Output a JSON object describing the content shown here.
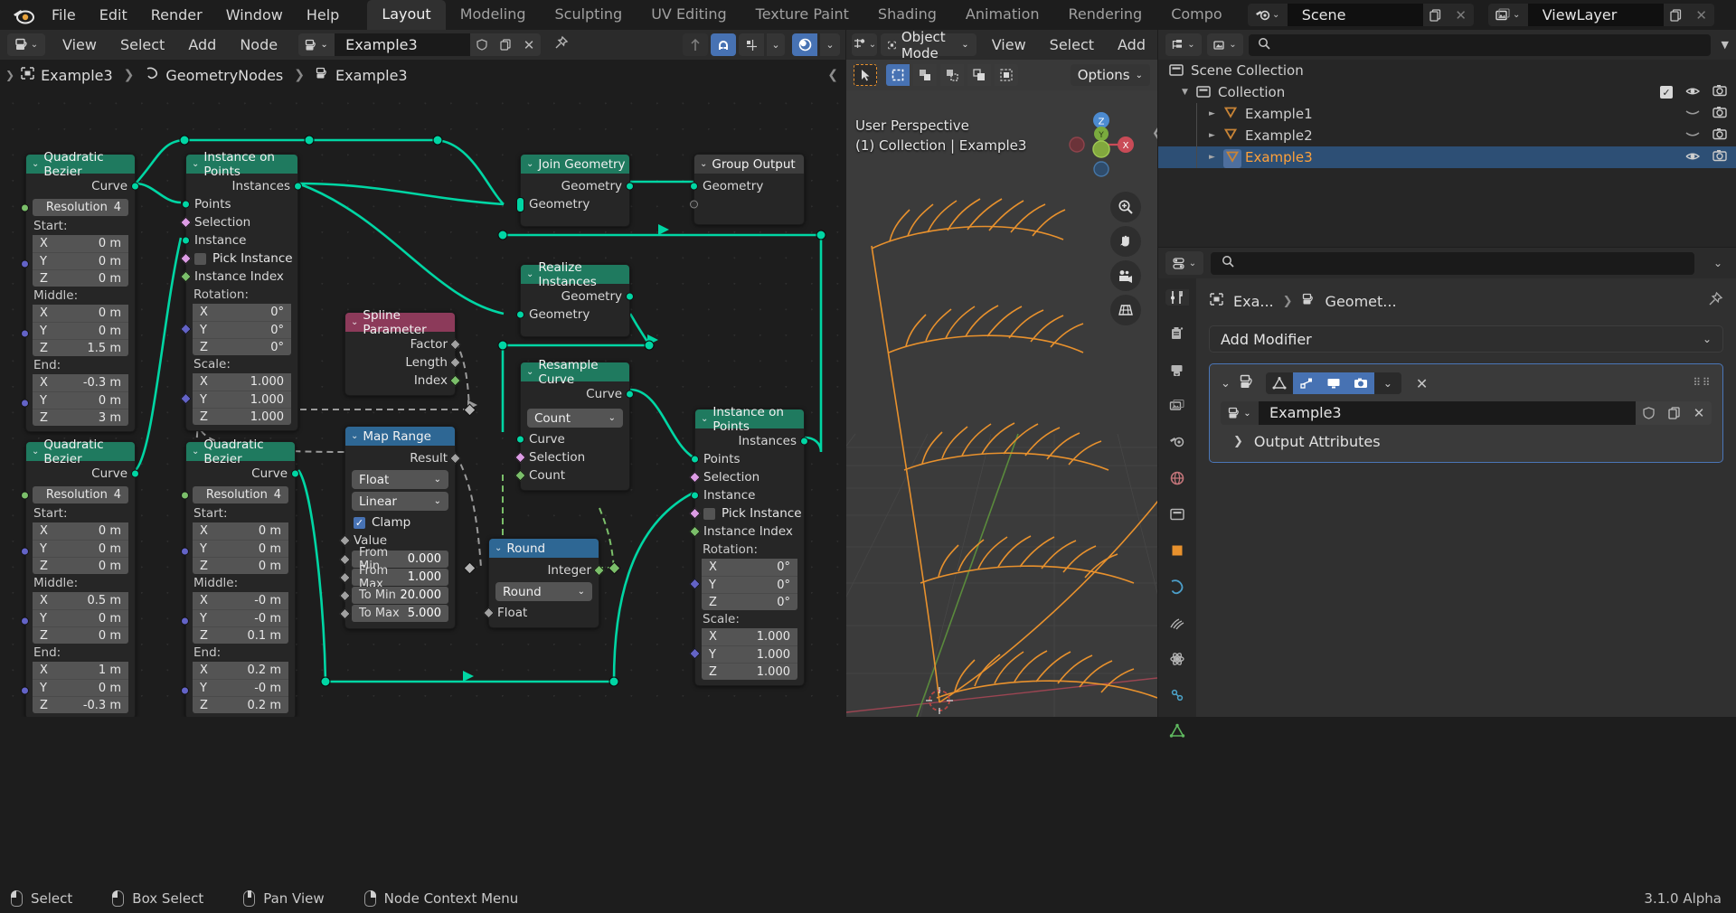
{
  "topbar": {
    "logo_icon": "blender-logo",
    "menus": [
      "File",
      "Edit",
      "Render",
      "Window",
      "Help"
    ],
    "workspace_tabs": [
      {
        "label": "Layout",
        "active": true
      },
      {
        "label": "Modeling",
        "active": false
      },
      {
        "label": "Sculpting",
        "active": false
      },
      {
        "label": "UV Editing",
        "active": false
      },
      {
        "label": "Texture Paint",
        "active": false
      },
      {
        "label": "Shading",
        "active": false
      },
      {
        "label": "Animation",
        "active": false
      },
      {
        "label": "Rendering",
        "active": false
      },
      {
        "label": "Compo",
        "active": false
      }
    ],
    "scene_name": "Scene",
    "viewlayer_name": "ViewLayer"
  },
  "node_editor": {
    "menus": [
      "View",
      "Select",
      "Add",
      "Node"
    ],
    "tree_name": "Example3",
    "breadcrumb": [
      "Example3",
      "GeometryNodes",
      "Example3"
    ],
    "nodes": {
      "qb1": {
        "title": "Quadratic Bezier",
        "out_curve": "Curve",
        "resolution_label": "Resolution",
        "resolution_value": "4",
        "start_label": "Start:",
        "start": {
          "x": "0 m",
          "y": "0 m",
          "z": "0 m"
        },
        "middle_label": "Middle:",
        "middle": {
          "x": "0 m",
          "y": "0 m",
          "z": "1.5 m"
        },
        "end_label": "End:",
        "end": {
          "x": "-0.3 m",
          "y": "0 m",
          "z": "3 m"
        },
        "axis": {
          "x": "X",
          "y": "Y",
          "z": "Z"
        }
      },
      "qb2": {
        "title": "Quadratic Bezier",
        "out_curve": "Curve",
        "resolution_label": "Resolution",
        "resolution_value": "4",
        "start_label": "Start:",
        "start": {
          "x": "0 m",
          "y": "0 m",
          "z": "0 m"
        },
        "middle_label": "Middle:",
        "middle": {
          "x": "0.5 m",
          "y": "0 m",
          "z": "0 m"
        },
        "end_label": "End:",
        "end": {
          "x": "1 m",
          "y": "0 m",
          "z": "-0.3 m"
        },
        "axis": {
          "x": "X",
          "y": "Y",
          "z": "Z"
        }
      },
      "qb3": {
        "title": "Quadratic Bezier",
        "out_curve": "Curve",
        "resolution_label": "Resolution",
        "resolution_value": "4",
        "start_label": "Start:",
        "start": {
          "x": "0 m",
          "y": "0 m",
          "z": "0 m"
        },
        "middle_label": "Middle:",
        "middle": {
          "x": "-0 m",
          "y": "-0 m",
          "z": "0.1 m"
        },
        "end_label": "End:",
        "end": {
          "x": "0.2 m",
          "y": "-0 m",
          "z": "0.2 m"
        },
        "axis": {
          "x": "X",
          "y": "Y",
          "z": "Z"
        }
      },
      "iop1": {
        "title": "Instance on Points",
        "out_instances": "Instances",
        "in_points": "Points",
        "in_selection": "Selection",
        "in_instance": "Instance",
        "in_pick_instance": "Pick Instance",
        "in_instance_index": "Instance Index",
        "rotation_label": "Rotation:",
        "rotation": {
          "x": "0°",
          "y": "0°",
          "z": "0°"
        },
        "scale_label": "Scale:",
        "scale": {
          "x": "1.000",
          "y": "1.000",
          "z": "1.000"
        },
        "axis": {
          "x": "X",
          "y": "Y",
          "z": "Z"
        }
      },
      "iop2": {
        "title": "Instance on Points",
        "out_instances": "Instances",
        "in_points": "Points",
        "in_selection": "Selection",
        "in_instance": "Instance",
        "in_pick_instance": "Pick Instance",
        "in_instance_index": "Instance Index",
        "rotation_label": "Rotation:",
        "rotation": {
          "x": "0°",
          "y": "0°",
          "z": "0°"
        },
        "scale_label": "Scale:",
        "scale": {
          "x": "1.000",
          "y": "1.000",
          "z": "1.000"
        },
        "axis": {
          "x": "X",
          "y": "Y",
          "z": "Z"
        }
      },
      "join": {
        "title": "Join Geometry",
        "out_geometry": "Geometry",
        "in_geometry": "Geometry"
      },
      "group_output": {
        "title": "Group Output",
        "in_geometry": "Geometry"
      },
      "realize": {
        "title": "Realize Instances",
        "out_geometry": "Geometry",
        "in_geometry": "Geometry"
      },
      "resample": {
        "title": "Resample Curve",
        "out_curve": "Curve",
        "mode": "Count",
        "in_curve": "Curve",
        "in_selection": "Selection",
        "in_count": "Count"
      },
      "spline_param": {
        "title": "Spline Parameter",
        "out_factor": "Factor",
        "out_length": "Length",
        "out_index": "Index"
      },
      "map_range": {
        "title": "Map Range",
        "out_result": "Result",
        "data_type": "Float",
        "interpolation": "Linear",
        "clamp_label": "Clamp",
        "clamp_on": true,
        "value_label": "Value",
        "from_min_label": "From Min",
        "from_min_value": "0.000",
        "from_max_label": "From Max",
        "from_max_value": "1.000",
        "to_min_label": "To Min",
        "to_min_value": "20.000",
        "to_max_label": "To Max",
        "to_max_value": "5.000"
      },
      "round": {
        "title": "Round",
        "out_integer": "Integer",
        "mode": "Round",
        "in_float": "Float"
      }
    }
  },
  "viewport": {
    "mode": "Object Mode",
    "menus": [
      "View",
      "Select",
      "Add"
    ],
    "options_label": "Options",
    "perspective_text": "User Perspective",
    "collection_text": "(1) Collection | Example3",
    "gizmo_axes": [
      "X",
      "Y",
      "Z"
    ]
  },
  "outliner": {
    "search_placeholder": "",
    "rows": [
      {
        "label": "Scene Collection",
        "indent": 0,
        "icon": "collection-icon",
        "selected": false,
        "expand": null,
        "checkbox": false,
        "eye": false,
        "camera": false
      },
      {
        "label": "Collection",
        "indent": 1,
        "icon": "collection-icon",
        "selected": false,
        "expand": "down",
        "checkbox": true,
        "eye": true,
        "camera": true
      },
      {
        "label": "Example1",
        "indent": 2,
        "icon": "curve-icon",
        "selected": false,
        "expand": "right",
        "checkbox": false,
        "eye": "closed",
        "camera": true
      },
      {
        "label": "Example2",
        "indent": 2,
        "icon": "curve-icon",
        "selected": false,
        "expand": "right",
        "checkbox": false,
        "eye": "closed",
        "camera": true
      },
      {
        "label": "Example3",
        "indent": 2,
        "icon": "curve-icon",
        "selected": true,
        "expand": "right",
        "checkbox": false,
        "eye": true,
        "camera": true
      }
    ]
  },
  "properties": {
    "search_placeholder": "",
    "breadcrumb_object": "Exa...",
    "breadcrumb_modifier": "Geomet...",
    "add_modifier_label": "Add Modifier",
    "modifier_name": "Example3",
    "output_attributes_label": "Output Attributes",
    "tabs": [
      "tool-icon",
      "render-icon",
      "printer-icon",
      "scene-icon",
      "world-icon",
      "collection-icon",
      "object-icon",
      "modifier-icon",
      "particles-icon",
      "physics-icon",
      "constraint-icon",
      "data-icon"
    ]
  },
  "statusbar": {
    "items": [
      {
        "icon": "mouse-left",
        "label": "Select"
      },
      {
        "icon": "mouse-left",
        "label": "Box Select"
      },
      {
        "icon": "mouse-middle",
        "label": "Pan View"
      },
      {
        "icon": "mouse-right",
        "label": "Node Context Menu"
      }
    ],
    "version": "3.1.0 Alpha"
  },
  "colors": {
    "accent_blue": "#4772b3",
    "geo_green": "#1f7a5f",
    "input_red": "#8c3a5a",
    "convert_blue": "#2e6794",
    "link_green": "#00d6a4",
    "orange": "#e8912d"
  }
}
